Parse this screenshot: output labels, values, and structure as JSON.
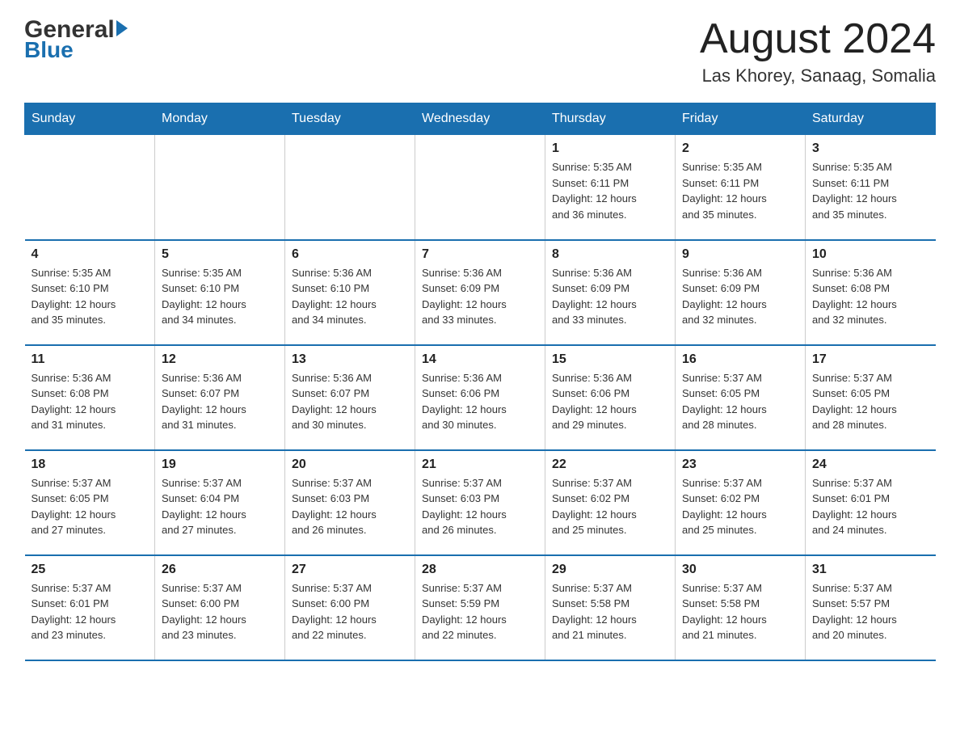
{
  "header": {
    "logo_general": "General",
    "logo_arrow": "▶",
    "logo_blue": "Blue",
    "month_title": "August 2024",
    "location": "Las Khorey, Sanaag, Somalia"
  },
  "days_of_week": [
    "Sunday",
    "Monday",
    "Tuesday",
    "Wednesday",
    "Thursday",
    "Friday",
    "Saturday"
  ],
  "weeks": [
    [
      {
        "day": "",
        "info": ""
      },
      {
        "day": "",
        "info": ""
      },
      {
        "day": "",
        "info": ""
      },
      {
        "day": "",
        "info": ""
      },
      {
        "day": "1",
        "info": "Sunrise: 5:35 AM\nSunset: 6:11 PM\nDaylight: 12 hours\nand 36 minutes."
      },
      {
        "day": "2",
        "info": "Sunrise: 5:35 AM\nSunset: 6:11 PM\nDaylight: 12 hours\nand 35 minutes."
      },
      {
        "day": "3",
        "info": "Sunrise: 5:35 AM\nSunset: 6:11 PM\nDaylight: 12 hours\nand 35 minutes."
      }
    ],
    [
      {
        "day": "4",
        "info": "Sunrise: 5:35 AM\nSunset: 6:10 PM\nDaylight: 12 hours\nand 35 minutes."
      },
      {
        "day": "5",
        "info": "Sunrise: 5:35 AM\nSunset: 6:10 PM\nDaylight: 12 hours\nand 34 minutes."
      },
      {
        "day": "6",
        "info": "Sunrise: 5:36 AM\nSunset: 6:10 PM\nDaylight: 12 hours\nand 34 minutes."
      },
      {
        "day": "7",
        "info": "Sunrise: 5:36 AM\nSunset: 6:09 PM\nDaylight: 12 hours\nand 33 minutes."
      },
      {
        "day": "8",
        "info": "Sunrise: 5:36 AM\nSunset: 6:09 PM\nDaylight: 12 hours\nand 33 minutes."
      },
      {
        "day": "9",
        "info": "Sunrise: 5:36 AM\nSunset: 6:09 PM\nDaylight: 12 hours\nand 32 minutes."
      },
      {
        "day": "10",
        "info": "Sunrise: 5:36 AM\nSunset: 6:08 PM\nDaylight: 12 hours\nand 32 minutes."
      }
    ],
    [
      {
        "day": "11",
        "info": "Sunrise: 5:36 AM\nSunset: 6:08 PM\nDaylight: 12 hours\nand 31 minutes."
      },
      {
        "day": "12",
        "info": "Sunrise: 5:36 AM\nSunset: 6:07 PM\nDaylight: 12 hours\nand 31 minutes."
      },
      {
        "day": "13",
        "info": "Sunrise: 5:36 AM\nSunset: 6:07 PM\nDaylight: 12 hours\nand 30 minutes."
      },
      {
        "day": "14",
        "info": "Sunrise: 5:36 AM\nSunset: 6:06 PM\nDaylight: 12 hours\nand 30 minutes."
      },
      {
        "day": "15",
        "info": "Sunrise: 5:36 AM\nSunset: 6:06 PM\nDaylight: 12 hours\nand 29 minutes."
      },
      {
        "day": "16",
        "info": "Sunrise: 5:37 AM\nSunset: 6:05 PM\nDaylight: 12 hours\nand 28 minutes."
      },
      {
        "day": "17",
        "info": "Sunrise: 5:37 AM\nSunset: 6:05 PM\nDaylight: 12 hours\nand 28 minutes."
      }
    ],
    [
      {
        "day": "18",
        "info": "Sunrise: 5:37 AM\nSunset: 6:05 PM\nDaylight: 12 hours\nand 27 minutes."
      },
      {
        "day": "19",
        "info": "Sunrise: 5:37 AM\nSunset: 6:04 PM\nDaylight: 12 hours\nand 27 minutes."
      },
      {
        "day": "20",
        "info": "Sunrise: 5:37 AM\nSunset: 6:03 PM\nDaylight: 12 hours\nand 26 minutes."
      },
      {
        "day": "21",
        "info": "Sunrise: 5:37 AM\nSunset: 6:03 PM\nDaylight: 12 hours\nand 26 minutes."
      },
      {
        "day": "22",
        "info": "Sunrise: 5:37 AM\nSunset: 6:02 PM\nDaylight: 12 hours\nand 25 minutes."
      },
      {
        "day": "23",
        "info": "Sunrise: 5:37 AM\nSunset: 6:02 PM\nDaylight: 12 hours\nand 25 minutes."
      },
      {
        "day": "24",
        "info": "Sunrise: 5:37 AM\nSunset: 6:01 PM\nDaylight: 12 hours\nand 24 minutes."
      }
    ],
    [
      {
        "day": "25",
        "info": "Sunrise: 5:37 AM\nSunset: 6:01 PM\nDaylight: 12 hours\nand 23 minutes."
      },
      {
        "day": "26",
        "info": "Sunrise: 5:37 AM\nSunset: 6:00 PM\nDaylight: 12 hours\nand 23 minutes."
      },
      {
        "day": "27",
        "info": "Sunrise: 5:37 AM\nSunset: 6:00 PM\nDaylight: 12 hours\nand 22 minutes."
      },
      {
        "day": "28",
        "info": "Sunrise: 5:37 AM\nSunset: 5:59 PM\nDaylight: 12 hours\nand 22 minutes."
      },
      {
        "day": "29",
        "info": "Sunrise: 5:37 AM\nSunset: 5:58 PM\nDaylight: 12 hours\nand 21 minutes."
      },
      {
        "day": "30",
        "info": "Sunrise: 5:37 AM\nSunset: 5:58 PM\nDaylight: 12 hours\nand 21 minutes."
      },
      {
        "day": "31",
        "info": "Sunrise: 5:37 AM\nSunset: 5:57 PM\nDaylight: 12 hours\nand 20 minutes."
      }
    ]
  ]
}
